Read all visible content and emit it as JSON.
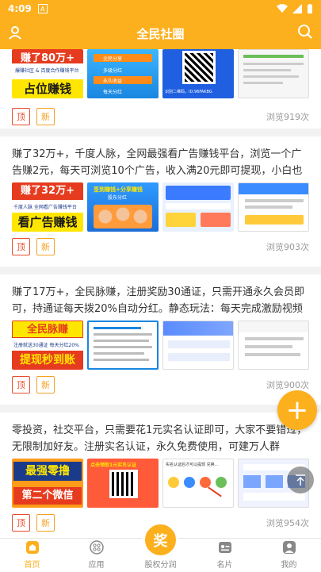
{
  "status_bar": {
    "time": "4:09",
    "notif_letter": "A"
  },
  "header": {
    "title": "全民社圈"
  },
  "colors": {
    "brand": "#fdb01e",
    "tag_top": "#e94b2a",
    "tag_new": "#f4a223"
  },
  "posts": [
    {
      "text": "",
      "thumb1_top": "赚了80万+",
      "thumb1_mid": "爆赚社区 & 百度合作赚钱平台",
      "thumb1_bottom": "占位赚钱",
      "thumb2_lines": [
        "全民分享",
        "多级分红",
        "永久收益",
        "每天分红"
      ],
      "thumb3_caption": "识别二维码，ID:96FAKBG",
      "tag_top": "顶",
      "tag_new": "新",
      "views": "浏览919次"
    },
    {
      "text": "赚了32万+，千度人脉，全网最强看广告赚钱平台，浏览一个广告赚2元，每天可浏览10个广告，收入满20元即可提现，小白也轻松赚...",
      "thumb1_top": "赚了32万+",
      "thumb1_mid": "千度人脉 全网看广告赚钱平台",
      "thumb1_bottom": "看广告赚钱",
      "thumb2_lines": [
        "签到赚钱+分享赚钱",
        "股东分红"
      ],
      "tag_top": "顶",
      "tag_new": "新",
      "views": "浏览903次"
    },
    {
      "text": "赚了17万+，全民脉赚，注册奖励30通证，只需开通永久会员即可，持通证每天拨20%自动分红。静态玩法：每天完成激励视频任务...",
      "thumb1_top": "全民脉赚",
      "thumb1_mid": "注册就送30通证  每天分红20%",
      "thumb1_bottom": "提现秒到账",
      "thumb2_lines": [],
      "tag_top": "顶",
      "tag_new": "新",
      "views": "浏览900次"
    },
    {
      "text": "零投资，社交平台，只需要花1元实名认证即可，大家不要错过，无限制加好友。注册实名认证，永久免费使用，可建万人群聊，...",
      "thumb1_top": "最强零撸",
      "thumb1_bottom": "第二个微信",
      "thumb2_lines": [
        "点击领取1元实名认证"
      ],
      "thumb3_caption": "实名认证后才可以提现 兑换...",
      "tag_top": "顶",
      "tag_new": "新",
      "views": "浏览954次"
    }
  ],
  "fab": {
    "label": "+"
  },
  "tabs": [
    {
      "label": "首页",
      "icon": "home-icon"
    },
    {
      "label": "应用",
      "icon": "apps-icon"
    },
    {
      "label": "股权分润",
      "icon": "award-icon"
    },
    {
      "label": "名片",
      "icon": "card-icon"
    },
    {
      "label": "我的",
      "icon": "user-icon"
    }
  ],
  "center_badge": "奖"
}
